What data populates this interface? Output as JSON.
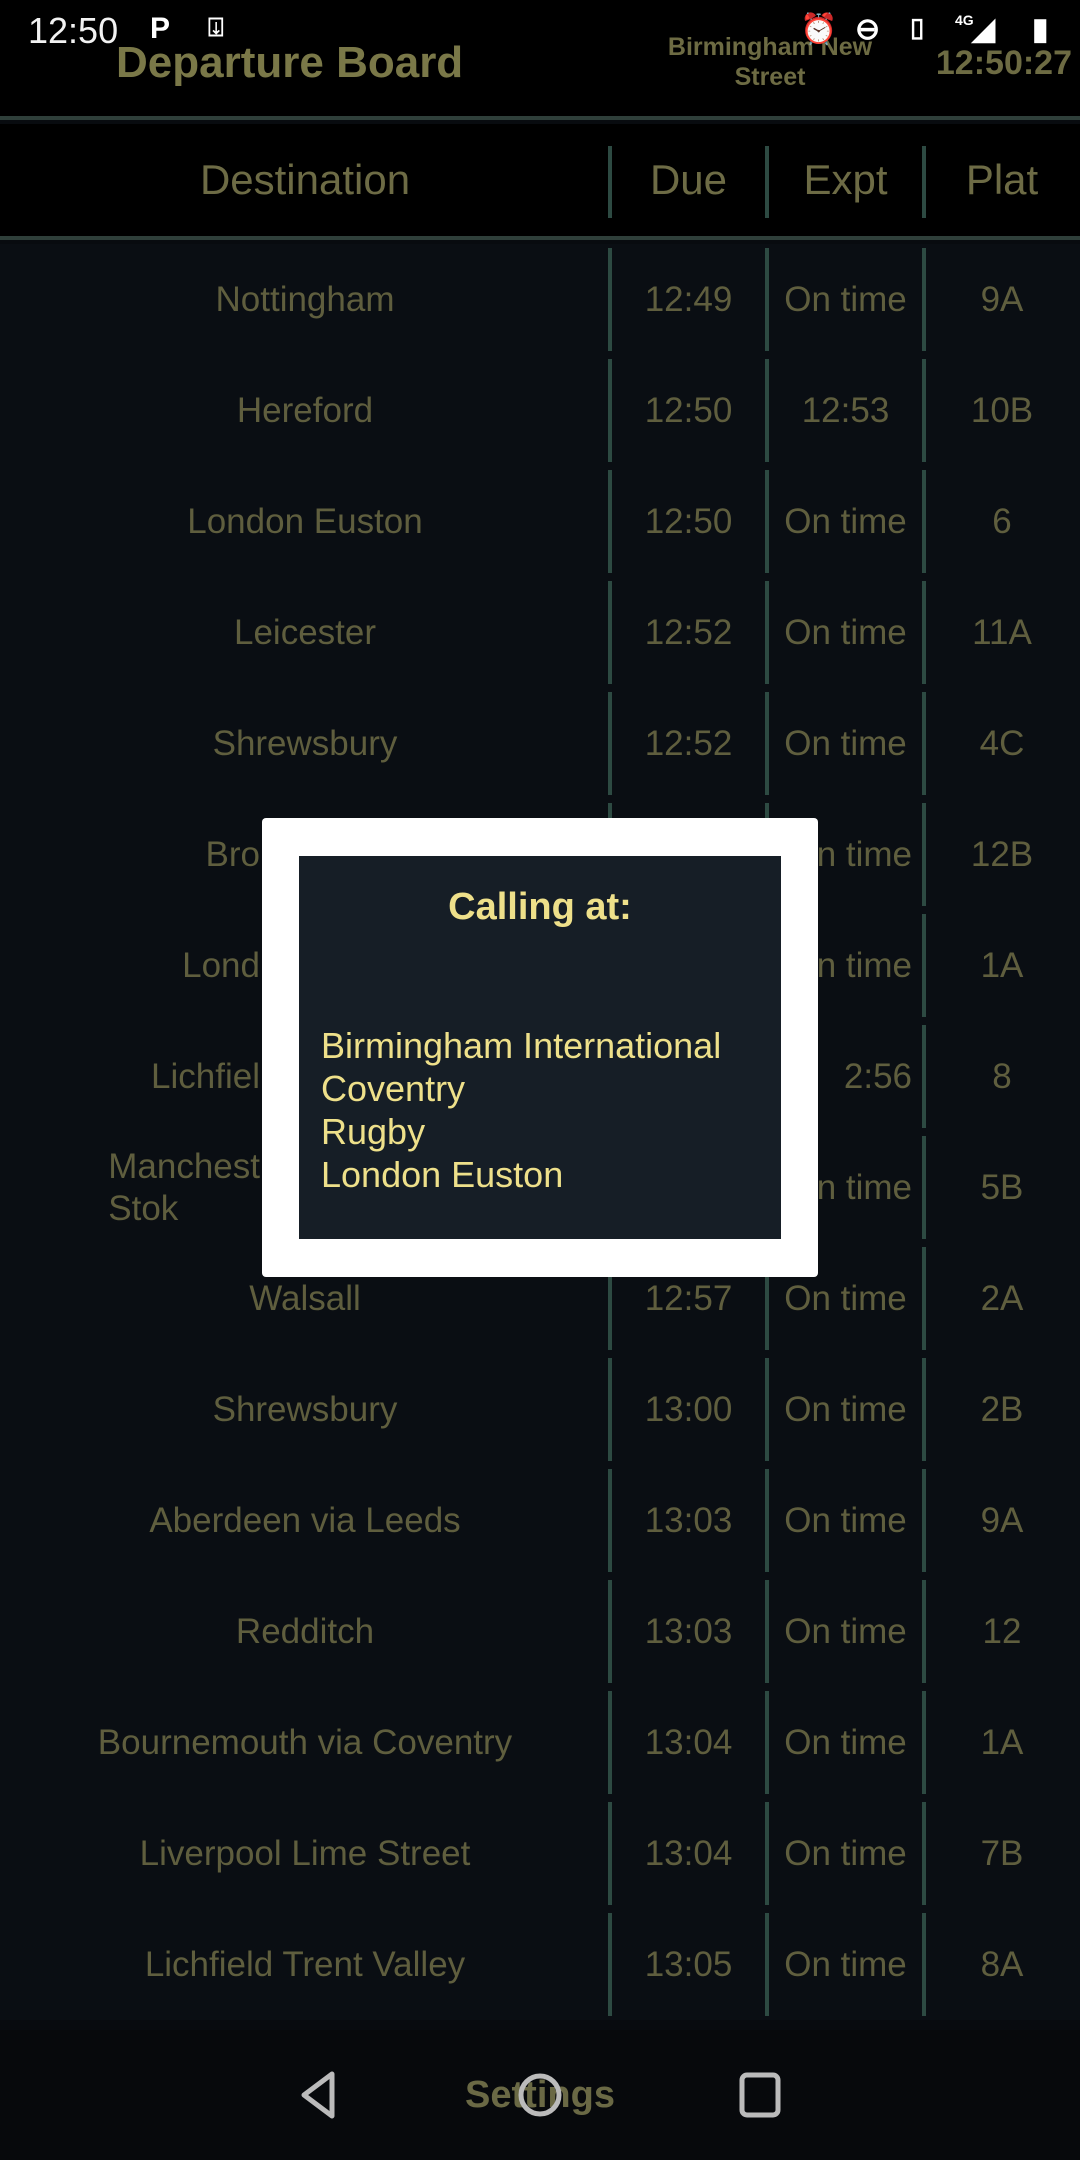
{
  "status_bar": {
    "time": "12:50",
    "network": "4G"
  },
  "header": {
    "title": "Departure Board",
    "station": "Birmingham New Street",
    "clock": "12:50:27"
  },
  "columns": [
    "Destination",
    "Due",
    "Expt",
    "Plat"
  ],
  "departures": [
    {
      "dest": "Nottingham",
      "due": "12:49",
      "expt": "On time",
      "plat": "9A"
    },
    {
      "dest": "Hereford",
      "due": "12:50",
      "expt": "12:53",
      "plat": "10B"
    },
    {
      "dest": "London Euston",
      "due": "12:50",
      "expt": "On time",
      "plat": "6"
    },
    {
      "dest": "Leicester",
      "due": "12:52",
      "expt": "On time",
      "plat": "11A"
    },
    {
      "dest": "Shrewsbury",
      "due": "12:52",
      "expt": "On time",
      "plat": "4C"
    },
    {
      "dest": "Bro",
      "due": "",
      "expt": "n time",
      "plat": "12B"
    },
    {
      "dest": "Lond",
      "due": "",
      "expt": "n time",
      "plat": "1A"
    },
    {
      "dest": "Lichfiel",
      "due": "",
      "expt": "2:56",
      "plat": "8"
    },
    {
      "dest": "Manchest\nStok",
      "due": "",
      "expt": "n time",
      "plat": "5B"
    },
    {
      "dest": "Walsall",
      "due": "12:57",
      "expt": "On time",
      "plat": "2A"
    },
    {
      "dest": "Shrewsbury",
      "due": "13:00",
      "expt": "On time",
      "plat": "2B"
    },
    {
      "dest": "Aberdeen via Leeds",
      "due": "13:03",
      "expt": "On time",
      "plat": "9A"
    },
    {
      "dest": "Redditch",
      "due": "13:03",
      "expt": "On time",
      "plat": "12"
    },
    {
      "dest": "Bournemouth via Coventry",
      "due": "13:04",
      "expt": "On time",
      "plat": "1A"
    },
    {
      "dest": "Liverpool Lime Street",
      "due": "13:04",
      "expt": "On time",
      "plat": "7B"
    },
    {
      "dest": "Lichfield Trent Valley",
      "due": "13:05",
      "expt": "On time",
      "plat": "8A"
    }
  ],
  "dialog": {
    "title": "Calling at:",
    "stops": [
      "Birmingham International",
      "Coventry",
      "Rugby",
      "London Euston"
    ]
  },
  "footer": {
    "settings_label": "Settings"
  },
  "colors": {
    "text": "#6b6a45",
    "divider": "#2d4a42",
    "dialog_text": "#eee08a",
    "dialog_bg": "#161e26"
  }
}
